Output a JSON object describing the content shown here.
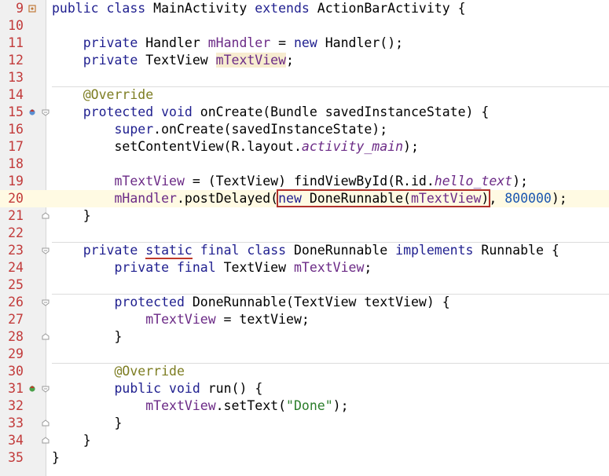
{
  "editor": {
    "lines": [
      {
        "num": "9"
      },
      {
        "num": "10"
      },
      {
        "num": "11"
      },
      {
        "num": "12"
      },
      {
        "num": "13"
      },
      {
        "num": "14"
      },
      {
        "num": "15"
      },
      {
        "num": "16"
      },
      {
        "num": "17"
      },
      {
        "num": "18"
      },
      {
        "num": "19"
      },
      {
        "num": "20"
      },
      {
        "num": "21"
      },
      {
        "num": "22"
      },
      {
        "num": "23"
      },
      {
        "num": "24"
      },
      {
        "num": "25"
      },
      {
        "num": "26"
      },
      {
        "num": "27"
      },
      {
        "num": "28"
      },
      {
        "num": "29"
      },
      {
        "num": "30"
      },
      {
        "num": "31"
      },
      {
        "num": "32"
      },
      {
        "num": "33"
      },
      {
        "num": "34"
      },
      {
        "num": "35"
      }
    ],
    "tokens": {
      "public": "public",
      "class": "class",
      "extends": "extends",
      "private": "private",
      "new": "new",
      "protected": "protected",
      "void": "void",
      "super": "super",
      "static": "static",
      "final": "final",
      "implements": "implements",
      "mainActivity": " MainActivity ",
      "actionBarTail": " ActionBarActivity {",
      "handlerDecl": " Handler ",
      "mHandler": "mHandler",
      "eq": " = ",
      "handlerInit": " Handler();",
      "textViewDecl": " TextView ",
      "mTextView": "mTextView",
      "semicolon": ";",
      "override": "@Override",
      "onCreateSig": " onCreate(Bundle savedInstanceState) {",
      "superCall": ".onCreate(savedInstanceState);",
      "setContentView": "setContentView(R.layout.",
      "activityMain": "activity_main",
      "closeParenSemi": ");",
      "castFind": " = (TextView) findViewById(R.id.",
      "helloText": "hello_text",
      "postDelayed": ".postDelayed(",
      "doneRunnableCall": " DoneRunnable(",
      "closeParen": ")",
      "commaSpace": ", ",
      "delayValue": "800000",
      "closeBrace": "}",
      "doneRunnableClass": " DoneRunnable ",
      "runnableTail": " Runnable {",
      "ctorSig": " DoneRunnable(TextView textView) {",
      "assignTextView": " = textView;",
      "runSig": " run() {",
      "setTextOpen": ".setText(",
      "doneString": "\"Done\"",
      "indent4": "    ",
      "indent8": "        ",
      "indent12": "            ",
      "space": " "
    }
  }
}
